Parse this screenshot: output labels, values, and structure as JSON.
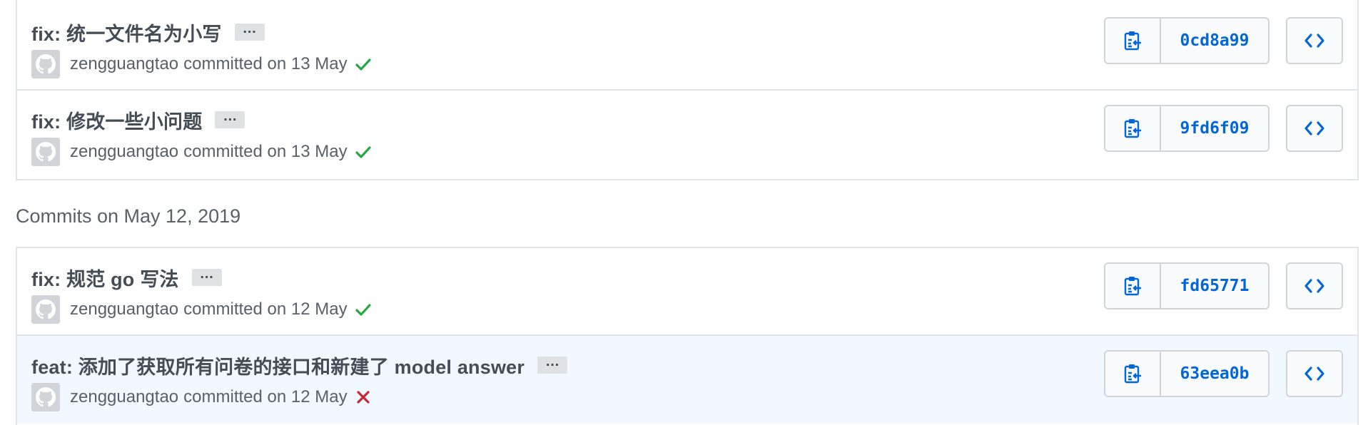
{
  "colors": {
    "link_blue": "#0366d6",
    "success_green": "#28a745",
    "failure_red": "#cb2431",
    "border": "#e1e4e8",
    "highlight_bg": "#f1f8ff"
  },
  "groups": [
    {
      "heading": "",
      "commits": [
        {
          "title": "fix: 统一文件名为小写",
          "ellipsis": "…",
          "author": "zengguangtao",
          "meta": "committed on 13 May",
          "status": "success",
          "status_icon": "check-icon",
          "sha": "0cd8a99"
        },
        {
          "title": "fix: 修改一些小问题",
          "ellipsis": "…",
          "author": "zengguangtao",
          "meta": "committed on 13 May",
          "status": "success",
          "status_icon": "check-icon",
          "sha": "9fd6f09"
        }
      ]
    },
    {
      "heading": "Commits on May 12, 2019",
      "commits": [
        {
          "title": "fix: 规范 go 写法",
          "ellipsis": "…",
          "author": "zengguangtao",
          "meta": "committed on 12 May",
          "status": "success",
          "status_icon": "check-icon",
          "sha": "fd65771"
        },
        {
          "title": "feat: 添加了获取所有问卷的接口和新建了 model answer",
          "ellipsis": "…",
          "author": "zengguangtao",
          "meta": "committed on 12 May",
          "status": "failure",
          "status_icon": "x-icon",
          "sha": "63eea0b"
        }
      ]
    }
  ],
  "icons": {
    "copy": "clippy-icon",
    "browse": "code-icon",
    "avatar": "github-octocat-icon"
  }
}
